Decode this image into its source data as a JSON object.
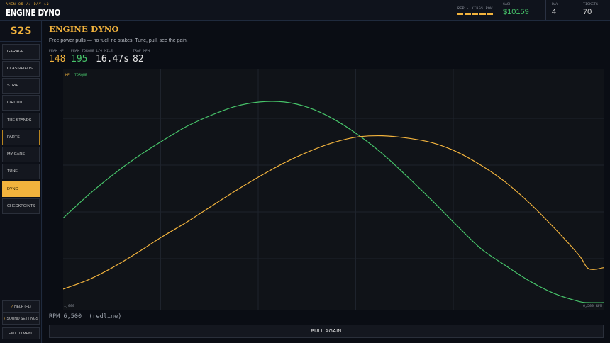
{
  "header": {
    "subtitle": "AMEN-05 // DAY 12",
    "title": "ENGINE DYNO",
    "rep_label": "REP · KINGS ROW",
    "rep_level": 5,
    "rep_max": 5,
    "cash_label": "CASH",
    "cash_value": "$10159",
    "day_label": "DAY",
    "day_value": "4",
    "tickets_label": "TICKETS",
    "tickets_value": "70"
  },
  "sidebar": {
    "logo": "S2S",
    "items": [
      {
        "label": "GARAGE"
      },
      {
        "label": "CLASSIFIEDS"
      },
      {
        "label": "STRIP"
      },
      {
        "label": "CIRCUIT"
      },
      {
        "label": "THE STANDS"
      },
      {
        "label": "PARTS"
      },
      {
        "label": "MY CARS"
      },
      {
        "label": "TUNE"
      },
      {
        "label": "DYNO"
      },
      {
        "label": "CHECKPOINTS"
      }
    ],
    "active": "DYNO",
    "highlighted": "PARTS",
    "help": {
      "icon": "?",
      "label": "HELP (F1)"
    },
    "sound": {
      "icon": "♪",
      "label": "SOUND SETTINGS"
    },
    "exit_label": "EXIT TO MENU"
  },
  "main": {
    "title": "ENGINE DYNO",
    "description": "Free power pulls — no fuel, no stakes. Tune, pull, see the gain.",
    "metrics": {
      "peak_hp_label": "PEAK HP",
      "peak_hp_value": "148",
      "peak_torque_label": "PEAK TORQUE",
      "peak_torque_value": "195",
      "quarter_label": "1/4 MILE",
      "quarter_value": "16.47s",
      "trap_label": "TRAP MPH",
      "trap_value": "82"
    },
    "rpm_readout": "RPM 6,500  (redline)",
    "pull_button": "PULL AGAIN"
  },
  "colors": {
    "accent": "#f2b33d",
    "hp": "#f2b33d",
    "torque": "#47c46a"
  },
  "chart_data": {
    "type": "line",
    "title": "",
    "xlabel": "",
    "ylabel": "",
    "xlim": [
      1000,
      6500
    ],
    "ylim": [
      0,
      205
    ],
    "x_min_label": "1,000",
    "x_max_label": "6,500 RPM",
    "grid": true,
    "legend": "top-left",
    "x": [
      1000,
      1250,
      1500,
      1750,
      2000,
      2250,
      2500,
      2750,
      3000,
      3250,
      3500,
      3750,
      4000,
      4250,
      4500,
      4750,
      5000,
      5250,
      5500,
      5750,
      6000,
      6250,
      6350,
      6500
    ],
    "series": [
      {
        "name": "HP",
        "color": "#f2b33d",
        "values": [
          12,
          20,
          31,
          44,
          58,
          71,
          85,
          99,
          112,
          124,
          134,
          142,
          147,
          148,
          146,
          142,
          134,
          122,
          107,
          88,
          66,
          42,
          30,
          31
        ]
      },
      {
        "name": "TORQUE",
        "color": "#47c46a",
        "values": [
          75,
          95,
          113,
          129,
          143,
          156,
          166,
          174,
          178,
          178,
          173,
          163,
          149,
          132,
          112,
          91,
          69,
          48,
          33,
          19,
          8,
          1,
          0,
          0
        ]
      }
    ]
  }
}
